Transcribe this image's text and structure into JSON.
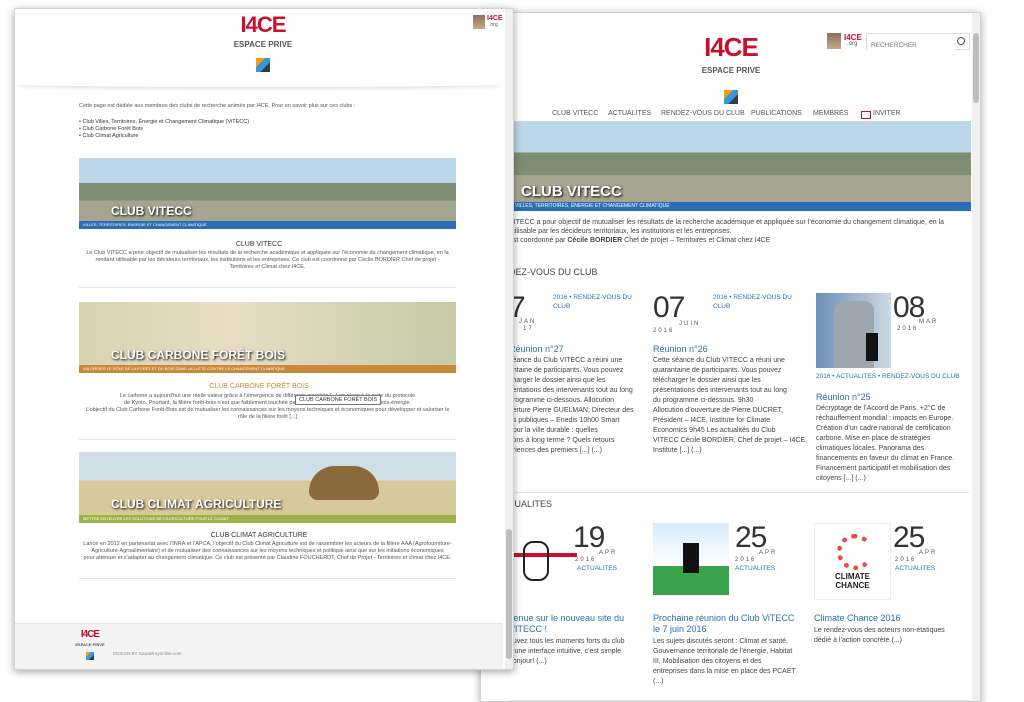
{
  "back": {
    "search_placeholder": "RECHERCHER",
    "logo": {
      "main": "I4CE",
      "sub": "ESPACE PRIVE"
    },
    "mini_logo": {
      "main": "I4CE",
      "sub": ".org"
    },
    "nav": [
      "CLUB VITECC",
      "ACTUALITES",
      "RENDEZ-VOUS DU CLUB",
      "PUBLICATIONS",
      "MEMBRES",
      "INVITER"
    ],
    "banner_title": "CLUB VITECC",
    "banner_sub": "VILLES, TERRITOIRES, ÉNERGIE ET CHANGEMENT CLIMATIQUE",
    "intro1": "VITECC a pour objectif de mutualiser les résultats de la recherche académique et appliquée sur l’économie du changement climatique, en la",
    "intro2": "utilisable par les décideurs territoriaux, les institutions et les entreprises.",
    "intro3_a": "est coordonné par ",
    "intro3_b": "Cécile BORDIER",
    "intro3_c": " Chef de projet – Territoires et Climat chez I4CE",
    "section_rdv": "DEZ-VOUS DU CLUB",
    "section_actu": "TUALITES",
    "rdv": [
      {
        "day": "7",
        "month": "JAN",
        "year": "17",
        "cats": "2016 • RENDEZ-VOUS DU CLUB",
        "title": "Réunion n°27",
        "text": [
          "séance du Club VITECC a réuni une",
          "antaine de participants. Vous pouvez",
          "charger le dossier ainsi que les",
          "sentations des intervenants tout au long",
          "programme ci-dessous.   Allocution",
          "verture Pierre GUELMAN, Directeur des",
          "es publiques – Enedis  10h00  Smart",
          "pour la ville durable : quelles",
          "tions à long terme ? Quels retours",
          "ériences des premiers [...] (...)"
        ]
      },
      {
        "day": "07",
        "month": "JUIN",
        "year": "2016",
        "cats": "2016 • RENDEZ-VOUS DU CLUB",
        "title": "Réunion n°26",
        "text": [
          "Cette séance du Club VITECC a réuni une",
          "quarantaine de participants. Vous pouvez",
          "télécharger le dossier ainsi que les",
          "présentations des intervenants tout au long",
          "du programme ci-dessous. 9h30",
          "Allocution d’ouverture de Pierre DUCRET,",
          "Président – I4CE, Institute for Climate",
          "Economics 9h45    Les actualités du Club",
          "VITECC Cécile BORDIER, Chef de projet – I4CE,",
          "Institute [...] (...)"
        ]
      },
      {
        "day": "08",
        "month": "MAR",
        "year": "2016",
        "cats": "2016 • ACTUALITES • RENDEZ-VOUS DU CLUB",
        "title": "Réunion n°25",
        "text": [
          "Décryptage de l’Accord de Paris. +2°C de",
          "réchauffement mondial : impacts en Europe.",
          "Création d’un cadre national de certification",
          "carbone. Mise en place de stratégies",
          "climatiques locales. Panorama des",
          "financements en faveur du climat en France.",
          "Financement participatif et mobilisation des",
          "citoyens [...] (...)"
        ]
      }
    ],
    "actu": [
      {
        "day": "19",
        "month": "APR",
        "year": "2016",
        "cats": "ACTUALITES",
        "title": "venue sur le nouveau site du\nVITECC !",
        "text": [
          "ouvez tous les moments forts du club",
          "s une interface intuitive, c’est simple",
          "bonjour! (...)"
        ]
      },
      {
        "day": "25",
        "month": "APR",
        "year": "2016",
        "cats": "ACTUALITES",
        "title": "Prochaine réunion du Club ViTECC\nle 7 juin 2016",
        "text": [
          "Les sujets discutés seront : Climat et santé,",
          "Gouvernance territoriale de l’énergie, Habitat",
          "III, Mobilisation des citoyens et des",
          "entreprises dans la mise en place des PCAET",
          "(...)"
        ]
      },
      {
        "day": "25",
        "month": "APR",
        "year": "2016",
        "cats": "ACTUALITES",
        "title": "Climate Chance 2016",
        "text": [
          "Le rendez-vous des acteurs non-étatiques",
          "dédié à l’action concrète (...)"
        ],
        "thumb_text": "CLIMATE\nCHANCE"
      }
    ]
  },
  "front": {
    "logo": {
      "main": "I4CE",
      "sub": "ESPACE PRIVE"
    },
    "mini_logo": {
      "main": "I4CE",
      "sub": ".org"
    },
    "intro": "Cette page est dédiée aux membres des clubs de recherche animés par I4CE. Pour en savoir plus sur ces clubs :",
    "links": [
      "Club Villes, Territoires, Énergie et Changement Climatique (ViTECC)",
      "Club Carbone Forêt Bois",
      "Club Climat Agriculture"
    ],
    "clubs": [
      {
        "banner_title": "CLUB VITECC",
        "band": "VILLES, TERRITOIRES, ÉNERGIE ET CHANGEMENT CLIMATIQUE",
        "heading": "CLUB VITECC",
        "text": [
          "Le Club VITECC a pour objectif de mutualiser les résultats de la recherche académique et appliquée sur l’économie du changement climatique, en la",
          "rendant utilisable par les décideurs territoriaux, les institutions et les entreprises. Ce club est coordonné par Cécile BORDIER Chef de projet -",
          "Territoires et Climat chez I4CE."
        ]
      },
      {
        "banner_title": "CLUB CARBONE FORÊT BOIS",
        "band": "VALORISER LE RÔLE DE LA FORÊT ET DU BOIS DANS LA LUTTE CONTRE LE CHANGEMENT CLIMATIQUE",
        "heading": "CLUB CARBONE FORÊT BOIS",
        "text": [
          "Le carbone a aujourd’hui une réelle valeur grâce à l’émergence de différents marchés [...] en place à la suite du protocole",
          "de Kyoto. Pourtant, la filière forêt-bois n’est que faiblement touchée par ces initiatives [...] valorisation du bois-énergie.",
          "L’objectif du Club Carbone Forêt-Bois est de mutualiser les connaissances sur les moyens techniques et économiques pour développer et valoriser le",
          "rôle de la filière forêt [...]"
        ]
      },
      {
        "banner_title": "CLUB CLIMAT AGRICULTURE",
        "band": "METTRE EN ŒUVRE LES SOLUTIONS DE L’AGRICULTURE POUR LE CLIMAT",
        "heading": "CLUB CLIMAT AGRICULTURE",
        "text": [
          "Lancé en 2012 en partenariat avec l’INRA et l’APCA, l’objectif du Club Climat Agriculture est de rassembler les acteurs de la filière AAA (Agrofourniture-",
          "Agriculture-Agroalimentaire) et de mutualiser des connaissances sur les moyens techniques et politique ainsi que sur les initiations économiques",
          "pour atténuer et s’adapter au changement climatique. Ce club est présenté par Claudine FOUCHERDT, Chef de Projet - Territoires et climat chez I4CE."
        ]
      }
    ],
    "tooltip": "CLUB CARBONE FORÊT BOIS",
    "footer_logo": {
      "main": "I4CE",
      "sub": "ESPACE PRIVE"
    },
    "footer_credit": "DESIGN BY Gaudefroyonline.com"
  }
}
